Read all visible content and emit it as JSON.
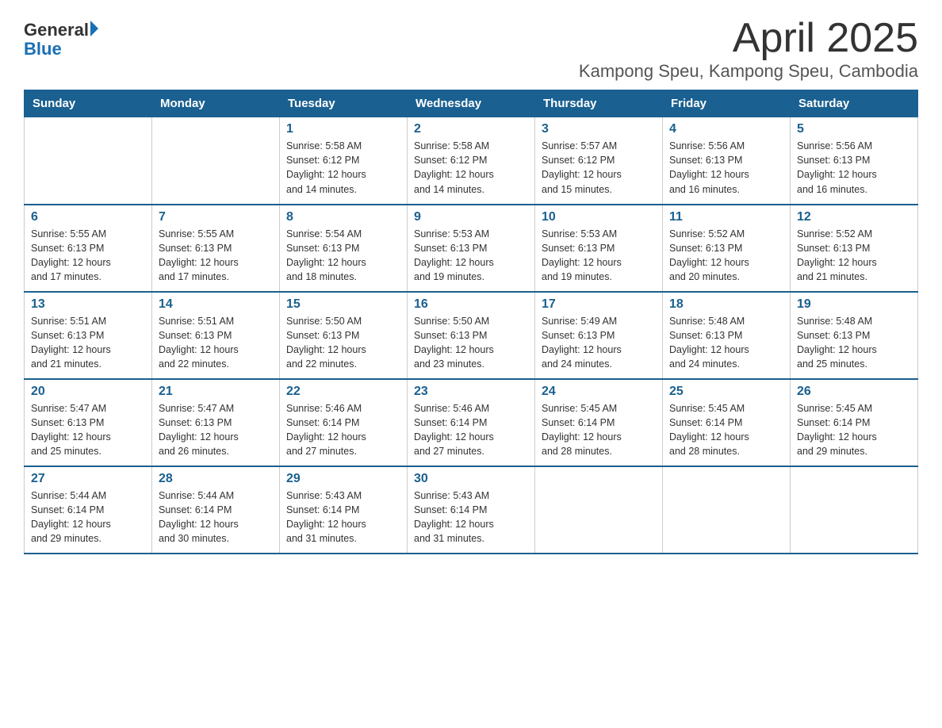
{
  "header": {
    "logo_general": "General",
    "logo_blue": "Blue",
    "title": "April 2025",
    "location": "Kampong Speu, Kampong Speu, Cambodia"
  },
  "weekdays": [
    "Sunday",
    "Monday",
    "Tuesday",
    "Wednesday",
    "Thursday",
    "Friday",
    "Saturday"
  ],
  "weeks": [
    [
      {
        "day": "",
        "info": ""
      },
      {
        "day": "",
        "info": ""
      },
      {
        "day": "1",
        "info": "Sunrise: 5:58 AM\nSunset: 6:12 PM\nDaylight: 12 hours\nand 14 minutes."
      },
      {
        "day": "2",
        "info": "Sunrise: 5:58 AM\nSunset: 6:12 PM\nDaylight: 12 hours\nand 14 minutes."
      },
      {
        "day": "3",
        "info": "Sunrise: 5:57 AM\nSunset: 6:12 PM\nDaylight: 12 hours\nand 15 minutes."
      },
      {
        "day": "4",
        "info": "Sunrise: 5:56 AM\nSunset: 6:13 PM\nDaylight: 12 hours\nand 16 minutes."
      },
      {
        "day": "5",
        "info": "Sunrise: 5:56 AM\nSunset: 6:13 PM\nDaylight: 12 hours\nand 16 minutes."
      }
    ],
    [
      {
        "day": "6",
        "info": "Sunrise: 5:55 AM\nSunset: 6:13 PM\nDaylight: 12 hours\nand 17 minutes."
      },
      {
        "day": "7",
        "info": "Sunrise: 5:55 AM\nSunset: 6:13 PM\nDaylight: 12 hours\nand 17 minutes."
      },
      {
        "day": "8",
        "info": "Sunrise: 5:54 AM\nSunset: 6:13 PM\nDaylight: 12 hours\nand 18 minutes."
      },
      {
        "day": "9",
        "info": "Sunrise: 5:53 AM\nSunset: 6:13 PM\nDaylight: 12 hours\nand 19 minutes."
      },
      {
        "day": "10",
        "info": "Sunrise: 5:53 AM\nSunset: 6:13 PM\nDaylight: 12 hours\nand 19 minutes."
      },
      {
        "day": "11",
        "info": "Sunrise: 5:52 AM\nSunset: 6:13 PM\nDaylight: 12 hours\nand 20 minutes."
      },
      {
        "day": "12",
        "info": "Sunrise: 5:52 AM\nSunset: 6:13 PM\nDaylight: 12 hours\nand 21 minutes."
      }
    ],
    [
      {
        "day": "13",
        "info": "Sunrise: 5:51 AM\nSunset: 6:13 PM\nDaylight: 12 hours\nand 21 minutes."
      },
      {
        "day": "14",
        "info": "Sunrise: 5:51 AM\nSunset: 6:13 PM\nDaylight: 12 hours\nand 22 minutes."
      },
      {
        "day": "15",
        "info": "Sunrise: 5:50 AM\nSunset: 6:13 PM\nDaylight: 12 hours\nand 22 minutes."
      },
      {
        "day": "16",
        "info": "Sunrise: 5:50 AM\nSunset: 6:13 PM\nDaylight: 12 hours\nand 23 minutes."
      },
      {
        "day": "17",
        "info": "Sunrise: 5:49 AM\nSunset: 6:13 PM\nDaylight: 12 hours\nand 24 minutes."
      },
      {
        "day": "18",
        "info": "Sunrise: 5:48 AM\nSunset: 6:13 PM\nDaylight: 12 hours\nand 24 minutes."
      },
      {
        "day": "19",
        "info": "Sunrise: 5:48 AM\nSunset: 6:13 PM\nDaylight: 12 hours\nand 25 minutes."
      }
    ],
    [
      {
        "day": "20",
        "info": "Sunrise: 5:47 AM\nSunset: 6:13 PM\nDaylight: 12 hours\nand 25 minutes."
      },
      {
        "day": "21",
        "info": "Sunrise: 5:47 AM\nSunset: 6:13 PM\nDaylight: 12 hours\nand 26 minutes."
      },
      {
        "day": "22",
        "info": "Sunrise: 5:46 AM\nSunset: 6:14 PM\nDaylight: 12 hours\nand 27 minutes."
      },
      {
        "day": "23",
        "info": "Sunrise: 5:46 AM\nSunset: 6:14 PM\nDaylight: 12 hours\nand 27 minutes."
      },
      {
        "day": "24",
        "info": "Sunrise: 5:45 AM\nSunset: 6:14 PM\nDaylight: 12 hours\nand 28 minutes."
      },
      {
        "day": "25",
        "info": "Sunrise: 5:45 AM\nSunset: 6:14 PM\nDaylight: 12 hours\nand 28 minutes."
      },
      {
        "day": "26",
        "info": "Sunrise: 5:45 AM\nSunset: 6:14 PM\nDaylight: 12 hours\nand 29 minutes."
      }
    ],
    [
      {
        "day": "27",
        "info": "Sunrise: 5:44 AM\nSunset: 6:14 PM\nDaylight: 12 hours\nand 29 minutes."
      },
      {
        "day": "28",
        "info": "Sunrise: 5:44 AM\nSunset: 6:14 PM\nDaylight: 12 hours\nand 30 minutes."
      },
      {
        "day": "29",
        "info": "Sunrise: 5:43 AM\nSunset: 6:14 PM\nDaylight: 12 hours\nand 31 minutes."
      },
      {
        "day": "30",
        "info": "Sunrise: 5:43 AM\nSunset: 6:14 PM\nDaylight: 12 hours\nand 31 minutes."
      },
      {
        "day": "",
        "info": ""
      },
      {
        "day": "",
        "info": ""
      },
      {
        "day": "",
        "info": ""
      }
    ]
  ]
}
